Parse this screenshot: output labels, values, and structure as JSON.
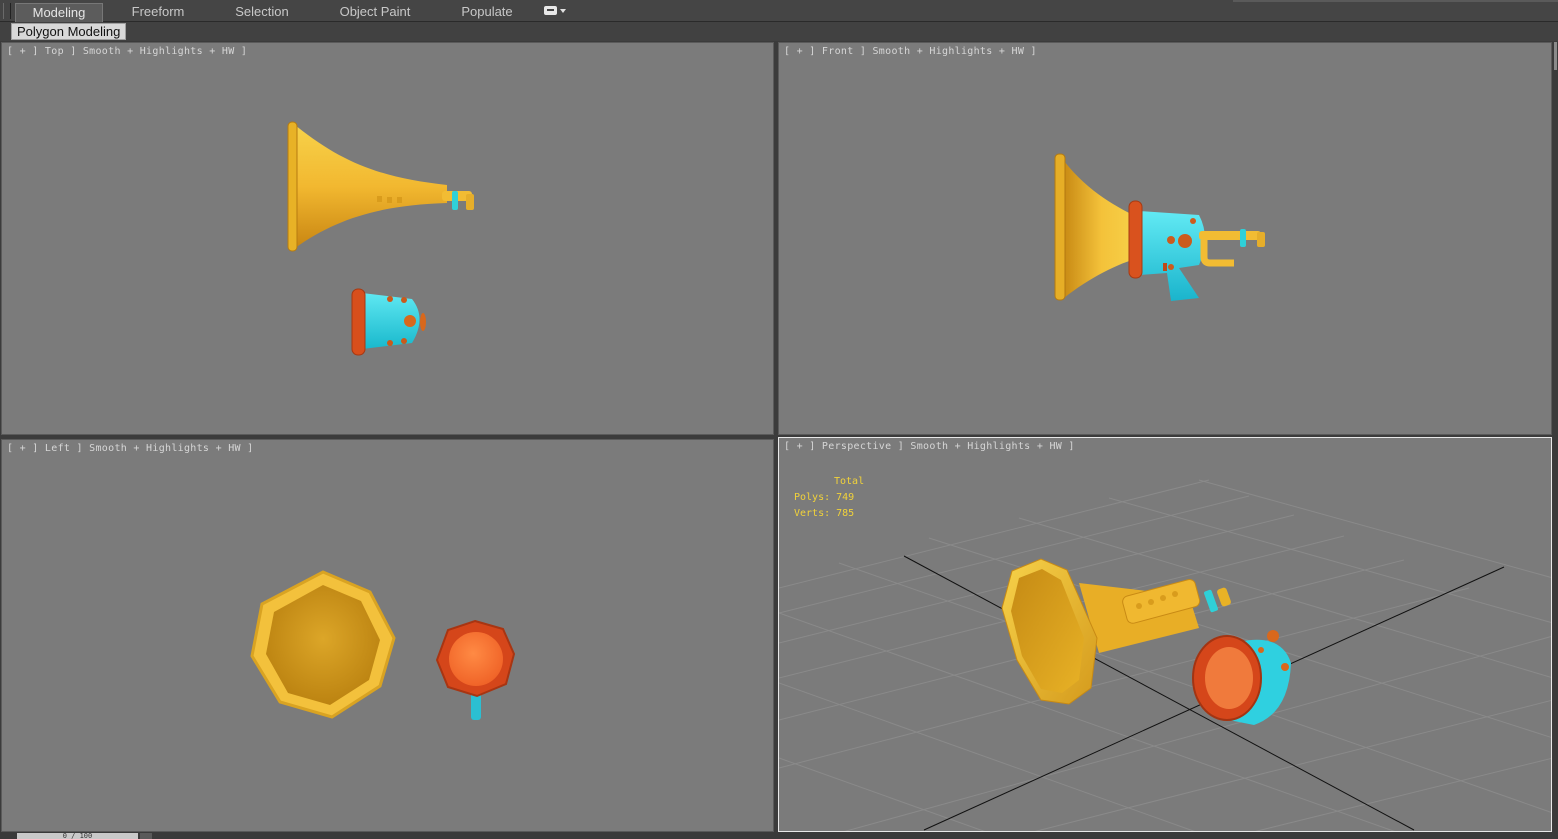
{
  "ribbon": {
    "tabs": [
      {
        "label": "Modeling",
        "active": true
      },
      {
        "label": "Freeform",
        "active": false
      },
      {
        "label": "Selection",
        "active": false
      },
      {
        "label": "Object Paint",
        "active": false
      },
      {
        "label": "Populate",
        "active": false
      }
    ],
    "panel_label": "Polygon Modeling"
  },
  "viewports": {
    "top": {
      "label": "[ + ] Top ] Smooth + Highlights + HW ]"
    },
    "front": {
      "label": "[ + ] Front ] Smooth + Highlights + HW ]"
    },
    "left": {
      "label": "[ + ] Left ] Smooth + Highlights + HW ]"
    },
    "perspective": {
      "label": "[ + ] Perspective ] Smooth + Highlights + HW ]",
      "stats": {
        "title": "Total",
        "polys": "Polys: 749",
        "verts": "Verts: 785"
      }
    }
  },
  "timeline": {
    "frame_label": "0 / 100"
  },
  "colors": {
    "viewport_bg": "#7b7b7b",
    "gold": "#f0b830",
    "cyan": "#2fd0e0",
    "orange_red": "#d9531f",
    "stats_text": "#f1d23a"
  }
}
